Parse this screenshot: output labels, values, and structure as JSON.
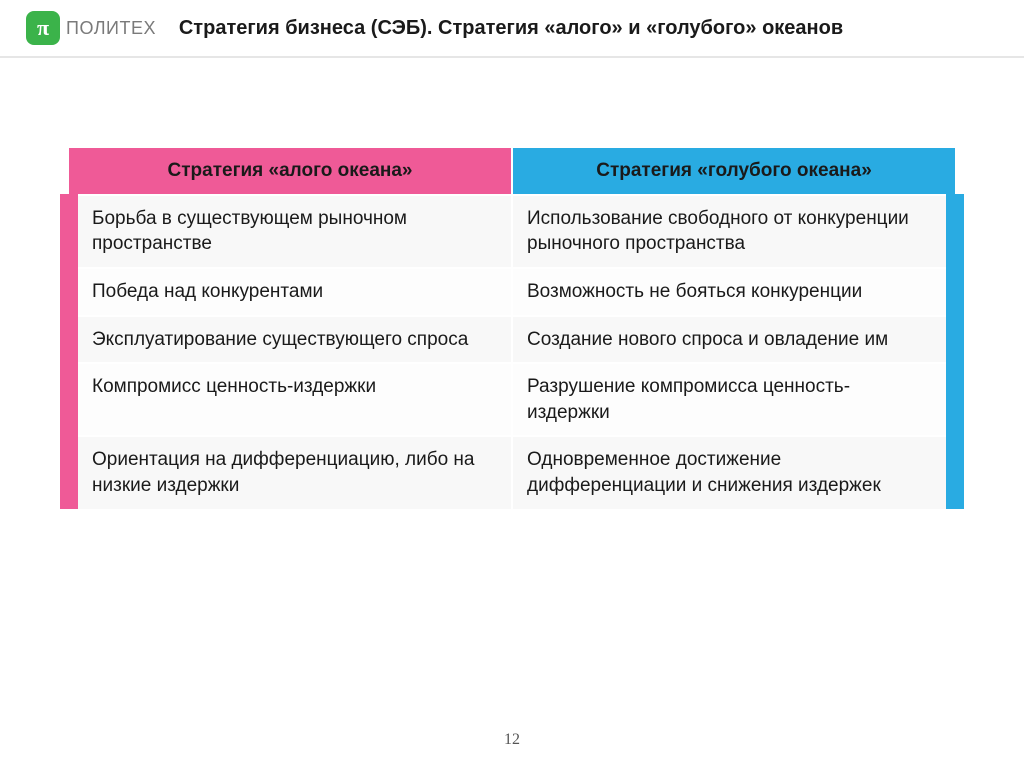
{
  "logo": {
    "mark": "π",
    "text": "ПОЛИТЕХ"
  },
  "title": "Стратегия бизнеса (СЭБ). Стратегия «алого» и «голубого» океанов",
  "table": {
    "head": {
      "red": "Стратегия «алого океана»",
      "blue": "Стратегия «голубого океана»"
    },
    "rows": [
      {
        "red": "Борьба в существующем рыночном пространстве",
        "blue": "Использование свободного от конкуренции рыночного пространства"
      },
      {
        "red": "Победа над конкурентами",
        "blue": "Возможность не бояться конкуренции"
      },
      {
        "red": "Эксплуатирование существующего спроса",
        "blue": "Создание нового спроса и овладение им"
      },
      {
        "red": "Компромисс ценность-издержки",
        "blue": "Разрушение компромисса ценность-издержки"
      },
      {
        "red": "Ориентация на дифференциацию, либо на низкие издержки",
        "blue": "Одновременное достижение дифференциации и снижения издержек"
      }
    ]
  },
  "page_number": "12"
}
